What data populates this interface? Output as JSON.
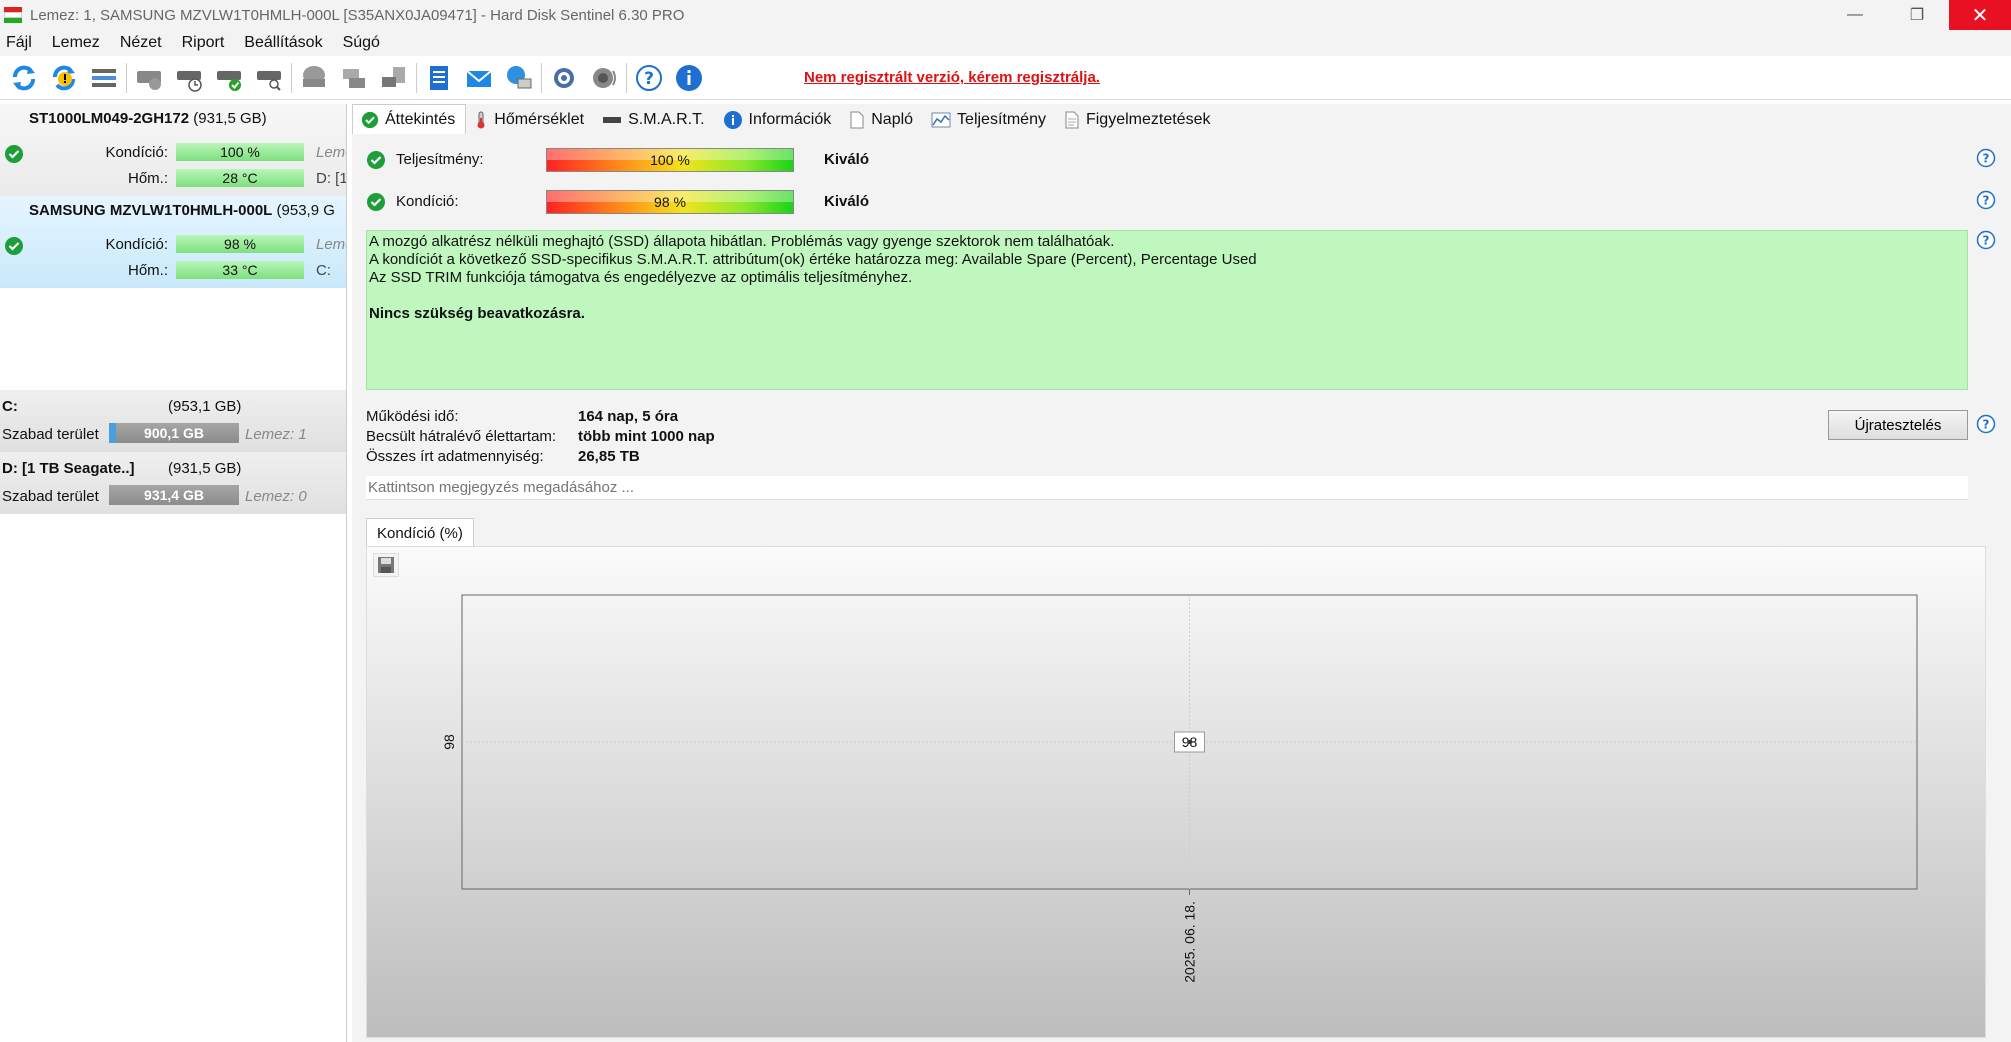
{
  "window": {
    "title": "Lemez: 1, SAMSUNG MZVLW1T0HMLH-000L [S35ANX0JA09471]  -  Hard Disk Sentinel 6.30 PRO",
    "minimize": "—",
    "maximize": "❐",
    "close": "✕"
  },
  "menu": [
    "Fájl",
    "Lemez",
    "Nézet",
    "Riport",
    "Beállítások",
    "Súgó"
  ],
  "toolbar": {
    "register_text": "Nem regisztrált verzió, kérem regisztrálja."
  },
  "disks": [
    {
      "model": "ST1000LM049-2GH172",
      "size": "(931,5 GB)",
      "condition_label": "Kondíció:",
      "condition_value": "100 %",
      "condition_aux": "Lemez",
      "temp_label": "Hőm.:",
      "temp_value": "28 °C",
      "temp_aux": "D: [1"
    },
    {
      "model": "SAMSUNG MZVLW1T0HMLH-000L",
      "size": "(953,9 G",
      "condition_label": "Kondíció:",
      "condition_value": "98 %",
      "condition_aux": "Leme",
      "temp_label": "Hőm.:",
      "temp_value": "33 °C",
      "temp_aux": "C:"
    }
  ],
  "volumes": [
    {
      "name": "C:",
      "size": "(953,1 GB)",
      "free_label": "Szabad terület",
      "free_value": "900,1 GB",
      "disk": "Lemez: 1",
      "used_fraction": 0.055
    },
    {
      "name": "D: [1 TB Seagate..]",
      "size": "(931,5 GB)",
      "free_label": "Szabad terület",
      "free_value": "931,4 GB",
      "disk": "Lemez: 0",
      "used_fraction": 0.0
    }
  ],
  "tabs": [
    "Áttekintés",
    "Hőmérséklet",
    "S.M.A.R.T.",
    "Információk",
    "Napló",
    "Teljesítmény",
    "Figyelmeztetések"
  ],
  "overview": {
    "performance_label": "Teljesítmény:",
    "performance_value": "100 %",
    "performance_rating": "Kiváló",
    "condition_label": "Kondíció:",
    "condition_value": "98 %",
    "condition_rating": "Kiváló",
    "status_lines": [
      "A mozgó alkatrész nélküli meghajtó (SSD) állapota hibátlan. Problémás vagy gyenge szektorok nem találhatóak.",
      "A kondíciót a következő SSD-specifikus S.M.A.R.T. attribútum(ok) értéke határozza meg:  Available Spare (Percent), Percentage Used",
      "Az SSD TRIM funkciója támogatva és engedélyezve az optimális teljesítményhez."
    ],
    "status_action": "Nincs szükség beavatkozásra.",
    "uptime_label": "Működési idő:",
    "uptime_value": "164 nap, 5 óra",
    "lifetime_label": "Becsült hátralévő élettartam:",
    "lifetime_value": "több mint 1000 nap",
    "written_label": "Összes írt adatmennyiség:",
    "written_value": "26,85 TB",
    "retest_button": "Újratesztelés",
    "note_placeholder": "Kattintson megjegyzés megadásához ..."
  },
  "chart_tab": "Kondíció  (%)",
  "chart_data": {
    "type": "line",
    "x": [
      "2025. 06. 18."
    ],
    "series": [
      {
        "values": [
          98
        ]
      }
    ],
    "y_tick_labels": [
      "98"
    ],
    "data_labels": [
      "98"
    ]
  }
}
